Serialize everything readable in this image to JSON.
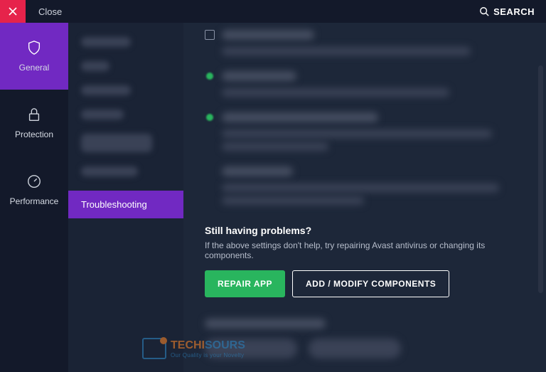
{
  "topbar": {
    "close_label": "Close",
    "search_label": "SEARCH"
  },
  "sidebar": {
    "items": [
      {
        "label": "General"
      },
      {
        "label": "Protection"
      },
      {
        "label": "Performance"
      }
    ]
  },
  "subnav": {
    "active_label": "Troubleshooting"
  },
  "problems": {
    "heading": "Still having problems?",
    "description": "If the above settings don't help, try repairing Avast antivirus or changing its components.",
    "repair_label": "REPAIR APP",
    "modify_label": "ADD / MODIFY COMPONENTS"
  },
  "watermark": {
    "brand_a": "TECHI",
    "brand_b": "SOURS",
    "tagline": "Our Quality is your Novelty"
  }
}
